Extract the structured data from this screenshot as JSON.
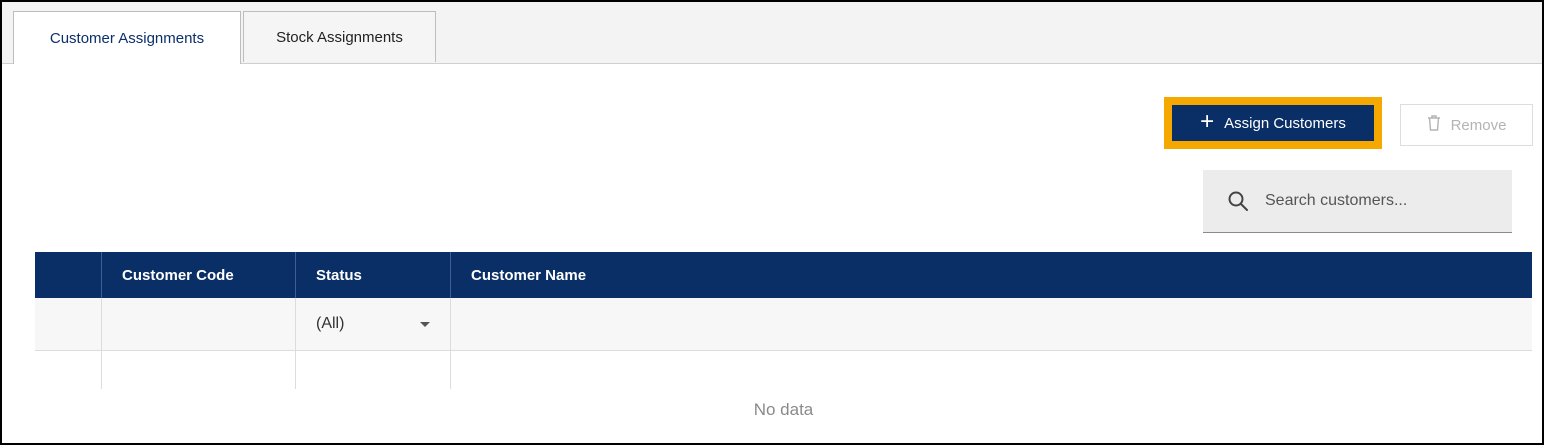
{
  "tabs": [
    {
      "label": "Customer Assignments",
      "active": true
    },
    {
      "label": "Stock Assignments",
      "active": false
    }
  ],
  "toolbar": {
    "assign_label": "Assign Customers",
    "assign_icon": "plus-icon",
    "remove_label": "Remove",
    "remove_icon": "trash-icon",
    "highlight_color": "#f5a800",
    "primary_color": "#0a2f66"
  },
  "search": {
    "placeholder": "Search customers...",
    "value": "",
    "icon": "search-icon"
  },
  "grid": {
    "columns": [
      "",
      "Customer Code",
      "Status",
      "Customer Name"
    ],
    "status_filter": "(All)",
    "empty_text": "No data"
  }
}
